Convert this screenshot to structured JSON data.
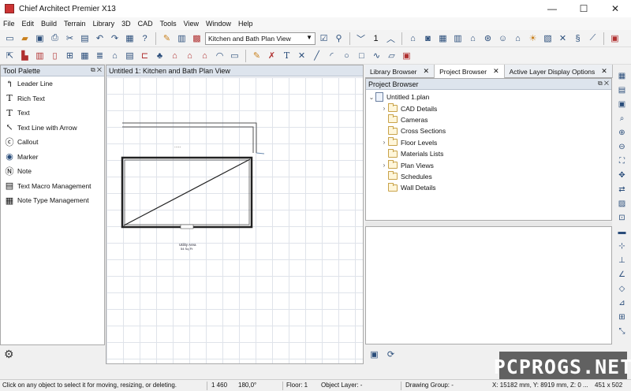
{
  "window": {
    "title": "Chief Architect Premier X13",
    "minimize": "—",
    "maximize": "☐",
    "close": "✕"
  },
  "menu": [
    "File",
    "Edit",
    "Build",
    "Terrain",
    "Library",
    "3D",
    "CAD",
    "Tools",
    "View",
    "Window",
    "Help"
  ],
  "toolbar": {
    "plan_view_select": "Kitchen and Bath Plan View",
    "count_value": "1"
  },
  "tool_palette": {
    "title": "Tool Palette",
    "items": [
      {
        "label": "Leader Line",
        "icon": "leader-line-icon"
      },
      {
        "label": "Rich Text",
        "icon": "rich-text-icon"
      },
      {
        "label": "Text",
        "icon": "text-icon"
      },
      {
        "label": "Text Line with Arrow",
        "icon": "text-arrow-icon"
      },
      {
        "label": "Callout",
        "icon": "callout-icon"
      },
      {
        "label": "Marker",
        "icon": "marker-icon"
      },
      {
        "label": "Note",
        "icon": "note-icon"
      },
      {
        "label": "Text Macro Management",
        "icon": "text-macro-icon"
      },
      {
        "label": "Note Type Management",
        "icon": "note-type-icon"
      }
    ]
  },
  "plan_window": {
    "title": "Untitled 1: Kitchen and Bath Plan View",
    "room_label": "Utility Area",
    "room_area": "54 Sq Ft",
    "dimension_text": "....."
  },
  "tabs": [
    {
      "label": "Library Browser",
      "active": false
    },
    {
      "label": "Project Browser",
      "active": true
    },
    {
      "label": "Active Layer Display Options",
      "active": false
    }
  ],
  "project_browser": {
    "title": "Project Browser",
    "root": "Untitled 1.plan",
    "nodes": [
      {
        "label": "CAD Details",
        "expandable": true
      },
      {
        "label": "Cameras",
        "expandable": false
      },
      {
        "label": "Cross Sections",
        "expandable": false
      },
      {
        "label": "Floor Levels",
        "expandable": true
      },
      {
        "label": "Materials Lists",
        "expandable": false
      },
      {
        "label": "Plan Views",
        "expandable": true
      },
      {
        "label": "Schedules",
        "expandable": false
      },
      {
        "label": "Wall Details",
        "expandable": false
      }
    ]
  },
  "status": {
    "message": "Click on any object to select it for moving, resizing, or deleting.",
    "length": "1 460",
    "angle": "180,0°",
    "floor": "Floor: 1",
    "object_layer": "Object Layer: -",
    "drawing_group": "Drawing Group: -",
    "coords": "X: 15182 mm, Y: 8919 mm, Z: 0 ...",
    "size": "451 x 502"
  },
  "watermark": "PCPROGS.NET",
  "colors": {
    "accent": "#2a4d7a",
    "panel_header": "#dde4ed",
    "grid": "#dfe3ea"
  }
}
